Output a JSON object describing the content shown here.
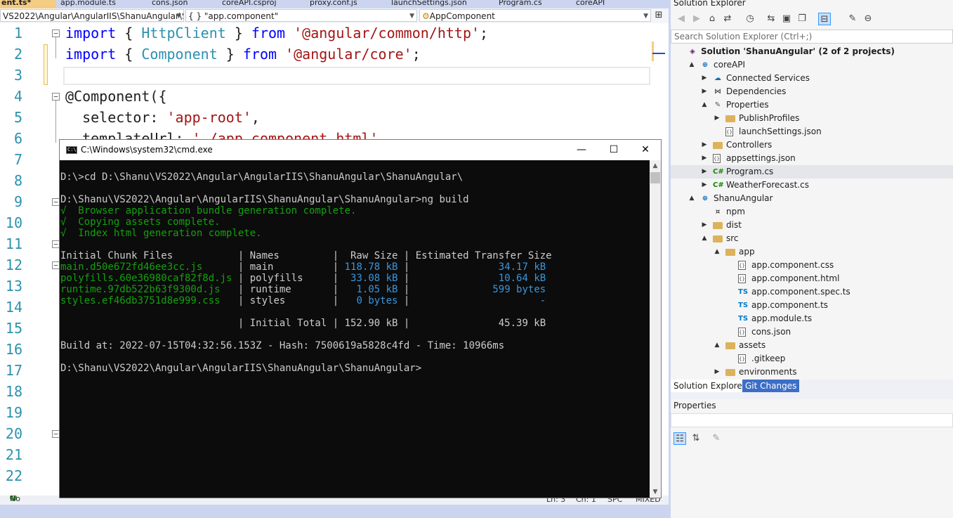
{
  "tabs": [
    {
      "label": "ent.ts*",
      "active": true
    },
    {
      "label": "app.module.ts"
    },
    {
      "label": "cons.json"
    },
    {
      "label": "coreAPI.csproj"
    },
    {
      "label": "proxy.conf.js"
    },
    {
      "label": "launchSettings.json"
    },
    {
      "label": "Program.cs"
    },
    {
      "label": "coreAPI"
    }
  ],
  "navbar": {
    "project": "VS2022\\Angular\\AngularIIS\\ShanuAngular\\Sh",
    "scope": "{ } \"app.component\"",
    "member": "AppComponent"
  },
  "line_numbers": [
    "1",
    "2",
    "3",
    "4",
    "5",
    "6",
    "7",
    "8",
    "9",
    "10",
    "11",
    "12",
    "13",
    "14",
    "15",
    "16",
    "17",
    "18",
    "19",
    "20",
    "21",
    "22"
  ],
  "code": {
    "l1": {
      "kw1": "import",
      "p1": " { ",
      "ty": "HttpClient",
      "p2": " } ",
      "kw2": "from",
      "p3": " ",
      "str": "'@angular/common/http'",
      "p4": ";"
    },
    "l2": {
      "kw1": "import",
      "p1": " { ",
      "ty": "Component",
      "p2": " } ",
      "kw2": "from",
      "p3": " ",
      "str": "'@angular/core'",
      "p4": ";"
    },
    "l4": "@Component({",
    "l5": {
      "key": "  selector: ",
      "str": "'app-root'",
      "end": ","
    },
    "l6": {
      "key": "  templateUrl: ",
      "str": "'./app.component.html'",
      "end": ","
    }
  },
  "editor_status": {
    "issues": "No issues found",
    "ln": "Ln: 3",
    "ch": "Ch: 1",
    "spc": "SPC",
    "mixed": "MIXED"
  },
  "cmd": {
    "title": "C:\\Windows\\system32\\cmd.exe",
    "icon_text": "C:\\",
    "lines": {
      "cd": "D:\\>cd D:\\Shanu\\VS2022\\Angular\\AngularIIS\\ShanuAngular\\ShanuAngular\\",
      "build": "D:\\Shanu\\VS2022\\Angular\\AngularIIS\\ShanuAngular\\ShanuAngular>ng build",
      "ok1": "√  Browser application bundle generation complete.",
      "ok2": "√  Copying assets complete.",
      "ok3": "√  Index html generation complete.",
      "header": "Initial Chunk Files           | Names         |  Raw Size | Estimated Transfer Size",
      "build_at": "Build at: 2022-07-15T04:32:56.153Z - Hash: 7500619a5828c4fd - Time: 10966ms",
      "prompt": "D:\\Shanu\\VS2022\\Angular\\AngularIIS\\ShanuAngular\\ShanuAngular>"
    },
    "rows": [
      {
        "file": "main.d50e672fd46ee3cc.js     ",
        "name": " main          ",
        "raw": " 118.78 kB ",
        "est": "               34.17 kB"
      },
      {
        "file": "polyfills.60e36980caf82f8d.js",
        "name": " polyfills     ",
        "raw": "  33.08 kB ",
        "est": "               10.64 kB"
      },
      {
        "file": "runtime.97db522b63f9300d.js  ",
        "name": " runtime       ",
        "raw": "   1.05 kB ",
        "est": "              599 bytes"
      },
      {
        "file": "styles.ef46db3751d8e999.css  ",
        "name": " styles        ",
        "raw": "   0 bytes ",
        "est": "                      -"
      }
    ],
    "total": {
      "label": "                              | Initial Total | 152.90 kB |",
      "est": "               45.39 kB"
    }
  },
  "solution_explorer": {
    "title": "Solution Explorer",
    "search_placeholder": "Search Solution Explorer (Ctrl+;)",
    "tree": [
      {
        "label": "Solution 'ShanuAngular' (2 of 2 projects)",
        "depth": 0,
        "icon": "sol",
        "exp": "",
        "bold": true
      },
      {
        "label": "coreAPI",
        "depth": 1,
        "icon": "proj",
        "exp": "▲"
      },
      {
        "label": "Connected Services",
        "depth": 2,
        "icon": "svc",
        "exp": "▶"
      },
      {
        "label": "Dependencies",
        "depth": 2,
        "icon": "dep",
        "exp": "▶"
      },
      {
        "label": "Properties",
        "depth": 2,
        "icon": "prop",
        "exp": "▲"
      },
      {
        "label": "PublishProfiles",
        "depth": 3,
        "icon": "folder",
        "exp": "▶"
      },
      {
        "label": "launchSettings.json",
        "depth": 3,
        "icon": "file",
        "exp": ""
      },
      {
        "label": "Controllers",
        "depth": 2,
        "icon": "folder",
        "exp": "▶"
      },
      {
        "label": "appsettings.json",
        "depth": 2,
        "icon": "file",
        "exp": "▶"
      },
      {
        "label": "Program.cs",
        "depth": 2,
        "icon": "cs",
        "exp": "▶",
        "highlight": true
      },
      {
        "label": "WeatherForecast.cs",
        "depth": 2,
        "icon": "cs",
        "exp": "▶"
      },
      {
        "label": "ShanuAngular",
        "depth": 1,
        "icon": "proj",
        "exp": "▲"
      },
      {
        "label": "npm",
        "depth": 2,
        "icon": "npm",
        "exp": ""
      },
      {
        "label": "dist",
        "depth": 2,
        "icon": "folder",
        "exp": "▶"
      },
      {
        "label": "src",
        "depth": 2,
        "icon": "folder",
        "exp": "▲"
      },
      {
        "label": "app",
        "depth": 3,
        "icon": "folder",
        "exp": "▲"
      },
      {
        "label": "app.component.css",
        "depth": 4,
        "icon": "file",
        "exp": ""
      },
      {
        "label": "app.component.html",
        "depth": 4,
        "icon": "file",
        "exp": ""
      },
      {
        "label": "app.component.spec.ts",
        "depth": 4,
        "icon": "ts",
        "exp": ""
      },
      {
        "label": "app.component.ts",
        "depth": 4,
        "icon": "ts",
        "exp": ""
      },
      {
        "label": "app.module.ts",
        "depth": 4,
        "icon": "ts",
        "exp": ""
      },
      {
        "label": "cons.json",
        "depth": 4,
        "icon": "file",
        "exp": ""
      },
      {
        "label": "assets",
        "depth": 3,
        "icon": "folder",
        "exp": "▲"
      },
      {
        "label": ".gitkeep",
        "depth": 4,
        "icon": "file",
        "exp": ""
      },
      {
        "label": "environments",
        "depth": 3,
        "icon": "folder",
        "exp": "▶"
      }
    ],
    "tab_solution": "Solution Explorer",
    "tab_git": "Git Changes"
  },
  "properties": {
    "title": "Properties"
  },
  "icons": {
    "cs": "C#",
    "ts": "TS",
    "npm": "¤",
    "sol": "◈",
    "proj": "⊕",
    "svc": "☁",
    "dep": "⋈",
    "prop": "✎",
    "file": "{}",
    "folder": ""
  },
  "colors": {
    "accent": "#3c6ec8",
    "active_tab": "#f5cc84",
    "cmd_green": "#13a10e",
    "cmd_cyan": "#3a96dd"
  }
}
